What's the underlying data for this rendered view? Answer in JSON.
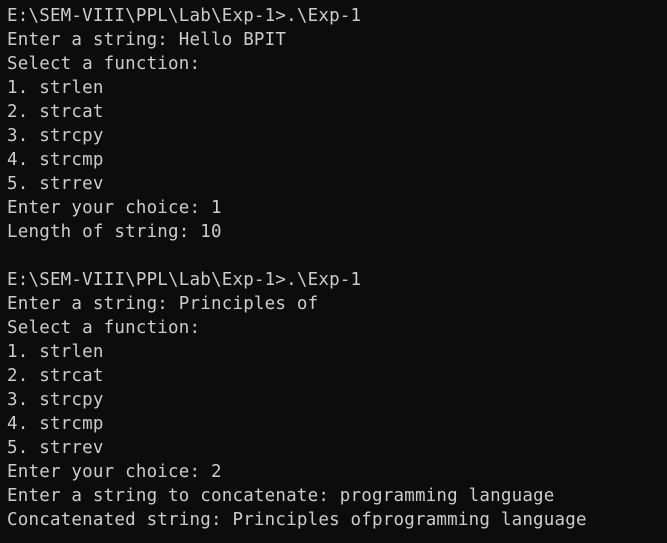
{
  "terminal": {
    "lines": [
      "E:\\SEM-VIII\\PPL\\Lab\\Exp-1>.\\Exp-1",
      "Enter a string: Hello BPIT",
      "Select a function:",
      "1. strlen",
      "2. strcat",
      "3. strcpy",
      "4. strcmp",
      "5. strrev",
      "Enter your choice: 1",
      "Length of string: 10",
      "",
      "E:\\SEM-VIII\\PPL\\Lab\\Exp-1>.\\Exp-1",
      "Enter a string: Principles of",
      "Select a function:",
      "1. strlen",
      "2. strcat",
      "3. strcpy",
      "4. strcmp",
      "5. strrev",
      "Enter your choice: 2",
      "Enter a string to concatenate: programming language",
      "Concatenated string: Principles ofprogramming language"
    ]
  }
}
